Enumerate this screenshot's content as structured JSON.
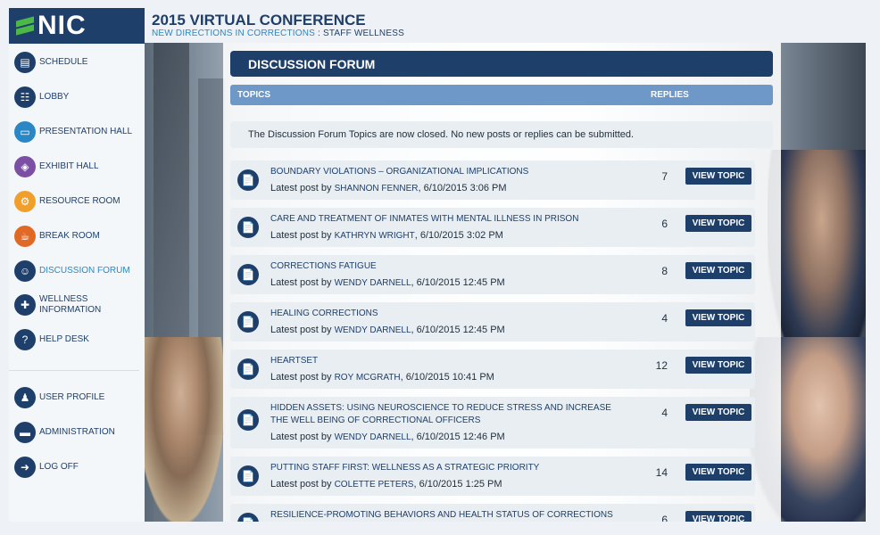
{
  "header": {
    "logo_text": "NIC",
    "title": "2015 VIRTUAL CONFERENCE",
    "subtitle_accent": "NEW DIRECTIONS IN CORRECTIONS",
    "subtitle_sep": " : ",
    "subtitle_rest": "STAFF WELLNESS"
  },
  "sidebar": {
    "items": [
      {
        "label": "SCHEDULE",
        "icon": "calendar-clock-icon",
        "glyph": "▤"
      },
      {
        "label": "LOBBY",
        "icon": "desk-icon",
        "glyph": "☷"
      },
      {
        "label": "PRESENTATION HALL",
        "icon": "presentation-icon",
        "glyph": "▭"
      },
      {
        "label": "EXHIBIT HALL",
        "icon": "cube-icon",
        "glyph": "◈"
      },
      {
        "label": "RESOURCE ROOM",
        "icon": "gear-icon",
        "glyph": "⚙"
      },
      {
        "label": "BREAK ROOM",
        "icon": "coffee-icon",
        "glyph": "☕"
      },
      {
        "label": "DISCUSSION FORUM",
        "icon": "people-icon",
        "glyph": "☺"
      },
      {
        "label": "WELLNESS INFORMATION",
        "icon": "medical-cross-icon",
        "glyph": "✚"
      },
      {
        "label": "HELP DESK",
        "icon": "help-icon",
        "glyph": "?"
      },
      {
        "label": "USER PROFILE",
        "icon": "user-icon",
        "glyph": "♟"
      },
      {
        "label": "ADMINISTRATION",
        "icon": "laptop-icon",
        "glyph": "▬"
      },
      {
        "label": "LOG OFF",
        "icon": "logout-icon",
        "glyph": "➜"
      }
    ],
    "active": "DISCUSSION FORUM"
  },
  "forum": {
    "heading": "DISCUSSION FORUM",
    "col_topics": "TOPICS",
    "col_replies": "REPLIES",
    "notice": "The Discussion Forum Topics are now closed. No new posts or replies can be submitted.",
    "latest_prefix": "Latest post by",
    "button_label": "VIEW TOPIC",
    "topics": [
      {
        "title": "BOUNDARY VIOLATIONS – ORGANIZATIONAL IMPLICATIONS",
        "author": "SHANNON FENNER",
        "date": ", 6/10/2015 3:06 PM",
        "replies": "7"
      },
      {
        "title": "CARE AND TREATMENT OF INMATES WITH MENTAL ILLNESS IN PRISON",
        "author": "KATHRYN WRIGHT",
        "date": ", 6/10/2015 3:02 PM",
        "replies": "6"
      },
      {
        "title": "CORRECTIONS FATIGUE",
        "author": "WENDY DARNELL",
        "date": ", 6/10/2015 12:45 PM",
        "replies": "8"
      },
      {
        "title": "HEALING CORRECTIONS",
        "author": "WENDY DARNELL",
        "date": ", 6/10/2015 12:45 PM",
        "replies": "4"
      },
      {
        "title": "HEARTSET",
        "author": "ROY MCGRATH",
        "date": ", 6/10/2015 10:41 PM",
        "replies": "12"
      },
      {
        "title": "HIDDEN ASSETS: USING NEUROSCIENCE TO REDUCE STRESS AND INCREASE THE WELL BEING OF CORRECTIONAL OFFICERS",
        "author": "WENDY DARNELL",
        "date": ", 6/10/2015 12:46 PM",
        "replies": "4"
      },
      {
        "title": "PUTTING STAFF FIRST: WELLNESS AS A STRATEGIC PRIORITY",
        "author": "COLETTE PETERS",
        "date": ", 6/10/2015 1:25 PM",
        "replies": "14"
      },
      {
        "title": "RESILIENCE-PROMOTING BEHAVIORS AND HEALTH STATUS OF CORRECTIONS",
        "author": "",
        "date": "",
        "replies": "6"
      }
    ]
  }
}
